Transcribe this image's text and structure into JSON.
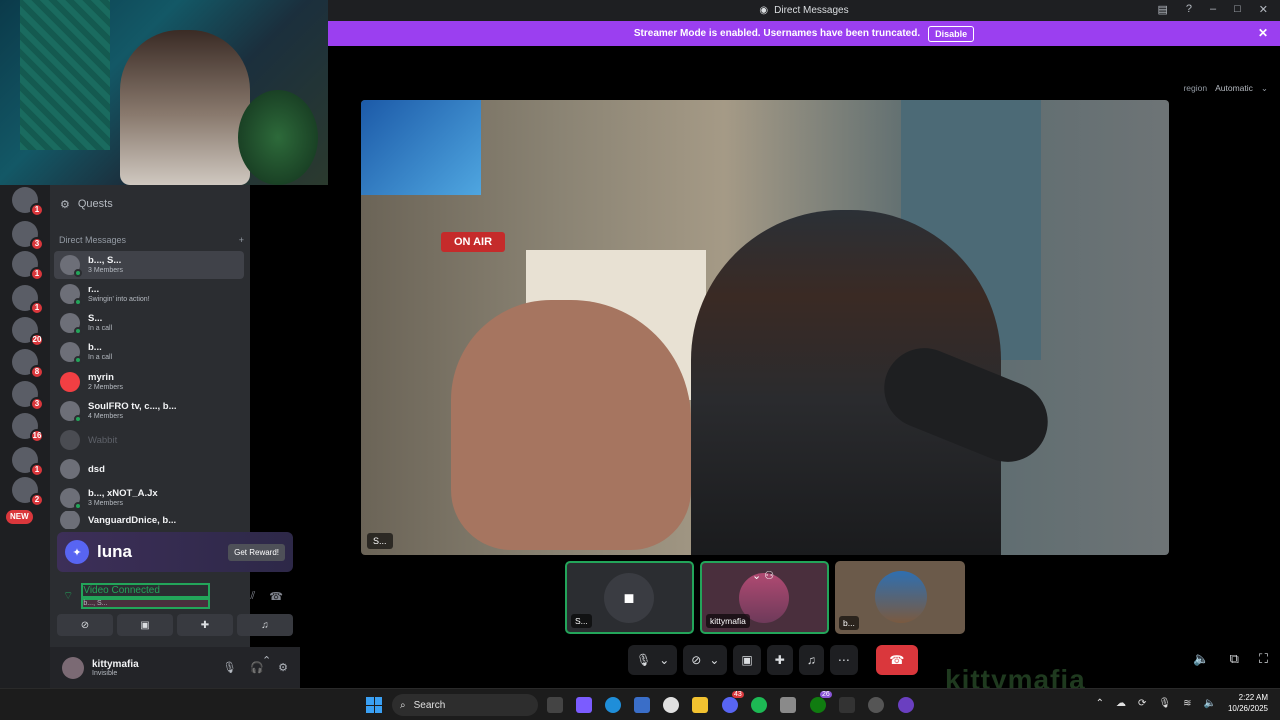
{
  "titlebar": {
    "title": "Direct Messages"
  },
  "streamer_banner": {
    "text": "Streamer Mode is enabled. Usernames have been truncated.",
    "button": "Disable",
    "color": "#9b3ff0"
  },
  "region": {
    "label": "region",
    "value": "Automatic"
  },
  "sidebar": {
    "quests_label": "Quests",
    "dm_header": "Direct Messages",
    "guild_badges": [
      "1",
      "3",
      "1",
      "1",
      "20",
      "8",
      "3",
      "16",
      "1",
      "2"
    ],
    "new_badge": "NEW",
    "dms": [
      {
        "name": "b..., S...",
        "sub": "3 Members"
      },
      {
        "name": "r...",
        "sub": "Swingin' into action!"
      },
      {
        "name": "S...",
        "sub": "In a call"
      },
      {
        "name": "b...",
        "sub": "In a call"
      },
      {
        "name": "myrin",
        "sub": "2 Members"
      },
      {
        "name": "SoulFRO tv, c..., b...",
        "sub": "4 Members"
      },
      {
        "name": "Wabbit",
        "sub": ""
      },
      {
        "name": "dsd",
        "sub": ""
      },
      {
        "name": "b..., xNOT_A.Jx",
        "sub": "3 Members"
      },
      {
        "name": "VanguardDnice, b...",
        "sub": ""
      }
    ]
  },
  "promo": {
    "brand": "luna",
    "button": "Get Reward!"
  },
  "voice": {
    "status": "Video Connected",
    "channel": "b..., S..."
  },
  "user": {
    "name": "kittymafia",
    "status": "Invisible"
  },
  "video": {
    "main_label": "S...",
    "on_air": "ON AIR"
  },
  "tiles": [
    {
      "label": "S..."
    },
    {
      "label": "kittymafia"
    },
    {
      "label": "b..."
    }
  ],
  "overlay_watermark": "kittymafia",
  "taskbar": {
    "search_placeholder": "Search",
    "time": "2:22 AM",
    "date": "10/26/2025",
    "badge_discord": "43",
    "badge_xbox": "26"
  }
}
